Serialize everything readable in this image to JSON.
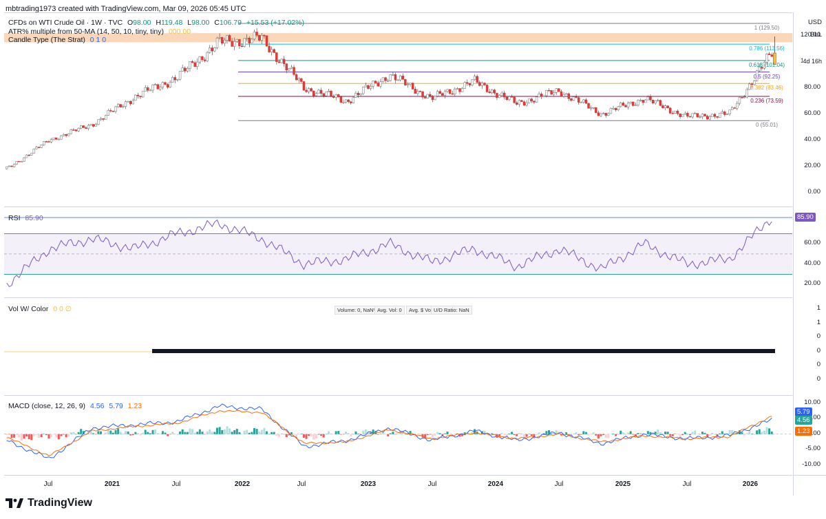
{
  "header": {
    "created_by": "mbtrading1973 created with TradingView.com, Mar 09, 2026 05:45 UTC",
    "symbol_title": "CFDs on WTI Crude Oil · 1W · TVC",
    "ohlc": {
      "o_label": "O",
      "o": "98.00",
      "h_label": "H",
      "h": "119.48",
      "l_label": "L",
      "l": "98.00",
      "c_label": "C",
      "c": "106.79",
      "chg": "+15.53 (+17.02%)"
    },
    "indicator1": "ATR% multiple from 50-MA (14, 50, 10, tiny, tiny)",
    "indicator1_value": "000.00",
    "indicator2": "Candle Type (The Strat)",
    "indicator2_values": "0  1  0"
  },
  "price_scale": {
    "currency": "USD",
    "unit": "BLL",
    "countdown": "4d 16h",
    "ticks": [
      "120.00",
      "100.00",
      "80.00",
      "60.00",
      "40.00",
      "20.00",
      "0.00"
    ]
  },
  "fib_levels": [
    {
      "label": "1 (129.50)",
      "value": 129.5,
      "color": "#787b86"
    },
    {
      "label": "0.786 (113.56)",
      "value": 113.56,
      "color": "#00bcd4"
    },
    {
      "label": "0.618 (101.04)",
      "value": 101.04,
      "color": "#089981"
    },
    {
      "label": "0.5 (92.25)",
      "value": 92.25,
      "color": "#673ab7"
    },
    {
      "label": "0.382 (83.46)",
      "value": 83.46,
      "color": "#f7a21b"
    },
    {
      "label": "0.236 (73.59)",
      "value": 73.59,
      "color": "#880e4f"
    },
    {
      "label": "0 (55.01)",
      "value": 55.01,
      "color": "#787b86"
    }
  ],
  "rsi": {
    "title": "RSI",
    "value": "85.90",
    "ticks": [
      "60.00",
      "40.00",
      "20.00"
    ],
    "color": "#7e57c2"
  },
  "volume": {
    "title": "Vol W/ Color",
    "flags": "0  0  ∅",
    "legend": [
      "Volume: 0, NaN%",
      "Avg. Vol: 0",
      "Avg. $ Vol: 0",
      "U/D Ratio: NaN"
    ],
    "ticks": [
      "1",
      "1",
      "0",
      "0",
      "0",
      "0"
    ]
  },
  "macd": {
    "title": "MACD (close, 12, 26, 9)",
    "macd_value": "4.56",
    "signal_value": "5.79",
    "hist_value": "1.23",
    "ticks": [
      "10.00",
      "5.00",
      "0.00",
      "-5.00",
      "-10.00"
    ],
    "badges": [
      "5.79",
      "4.56",
      "1.23"
    ],
    "macd_color": "#2962ff",
    "signal_color": "#ff6d00"
  },
  "time_axis": [
    "Jul",
    "2021",
    "Jul",
    "2022",
    "Jul",
    "2023",
    "Jul",
    "2024",
    "Jul",
    "2025",
    "Jul",
    "2026"
  ],
  "footer": {
    "brand": "TradingView"
  },
  "chart_data": {
    "type": "candlestick",
    "title": "CFDs on WTI Crude Oil · 1W · TVC",
    "x": [
      "2020-04",
      "2020-07",
      "2021-01",
      "2021-07",
      "2022-01",
      "2022-03",
      "2022-06",
      "2022-12",
      "2023-06",
      "2023-09",
      "2024-01",
      "2024-04",
      "2024-09",
      "2025-01",
      "2025-04",
      "2025-06",
      "2025-10",
      "2026-01",
      "2026-03"
    ],
    "close": [
      18,
      40,
      52,
      73,
      88,
      115,
      118,
      80,
      70,
      90,
      72,
      85,
      68,
      78,
      60,
      72,
      58,
      60,
      106.79
    ],
    "ylim": [
      -5,
      130
    ],
    "rsi": [
      20,
      55,
      65,
      55,
      70,
      80,
      65,
      40,
      45,
      60,
      42,
      55,
      38,
      55,
      35,
      60,
      40,
      45,
      85.9
    ],
    "macd_line": [
      -2,
      -8,
      2,
      3,
      4,
      9,
      8,
      -4,
      -2,
      2,
      -2,
      1,
      -2,
      0.5,
      -3,
      0,
      -1.5,
      -0.5,
      4.56
    ],
    "signal_line": [
      -1,
      -7,
      1,
      2.5,
      3.5,
      7.5,
      7,
      -3,
      -2.5,
      1.5,
      -1.5,
      0.5,
      -1.5,
      0,
      -2.5,
      -0.5,
      -1.5,
      -0.8,
      5.79
    ],
    "histogram": [
      -1,
      -1,
      1,
      0.5,
      0.5,
      1.5,
      1,
      -1,
      0.5,
      0.5,
      -0.5,
      0.5,
      -0.5,
      0.5,
      -0.5,
      0.5,
      0,
      0.3,
      1.23
    ]
  }
}
